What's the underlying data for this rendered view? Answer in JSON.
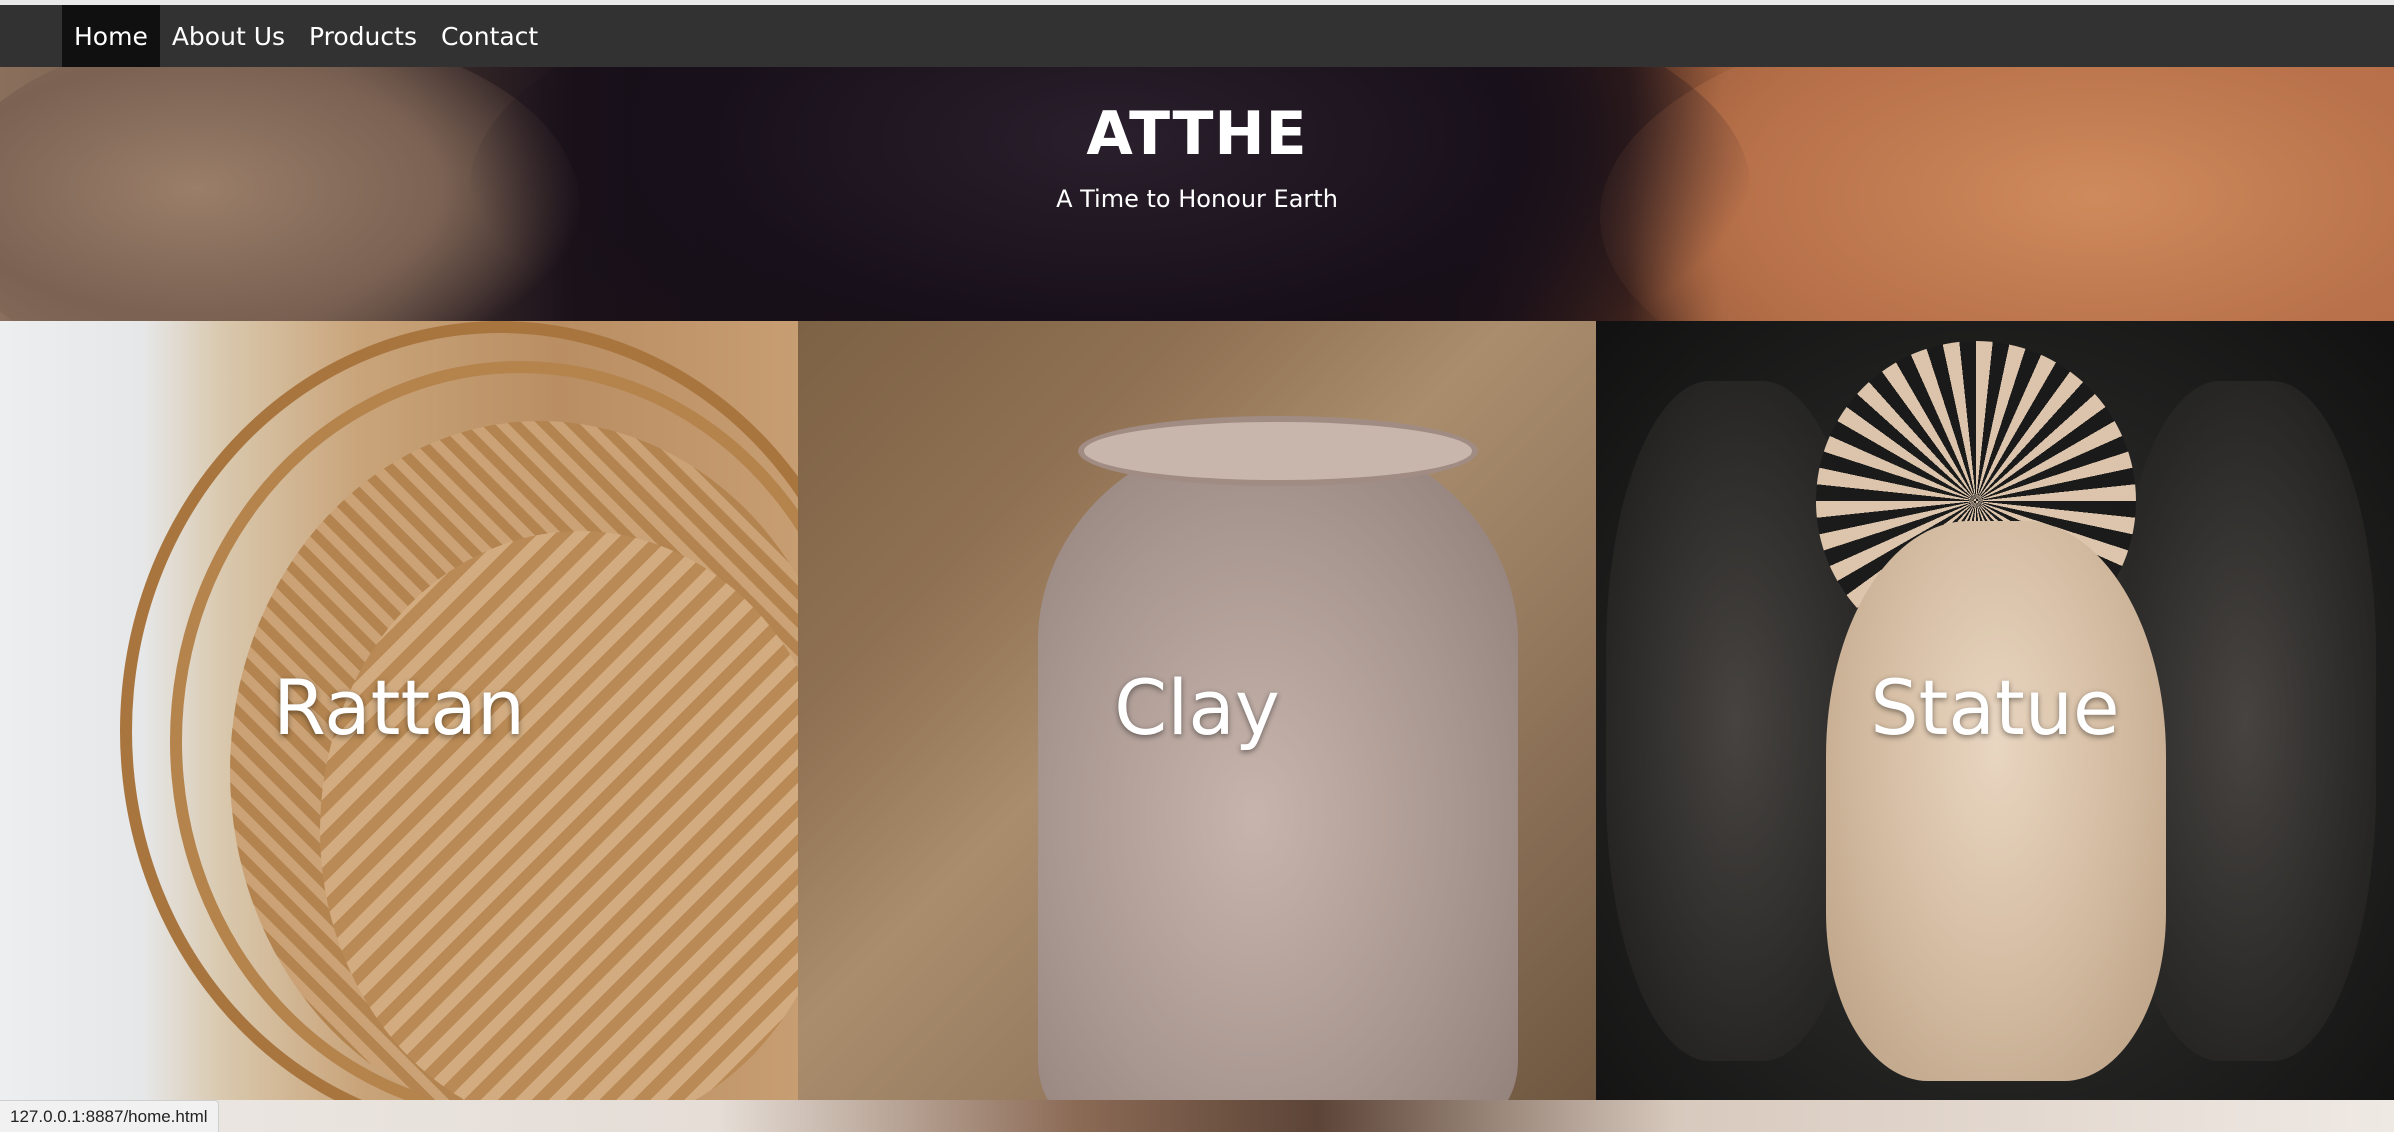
{
  "nav": {
    "items": [
      {
        "label": "Home",
        "active": true
      },
      {
        "label": "About Us",
        "active": false
      },
      {
        "label": "Products",
        "active": false
      },
      {
        "label": "Contact",
        "active": false
      }
    ]
  },
  "hero": {
    "title": "ATTHE",
    "subtitle": "A Time to Honour Earth"
  },
  "categories": [
    {
      "label": "Rattan"
    },
    {
      "label": "Clay"
    },
    {
      "label": "Statue"
    }
  ],
  "status_bar": {
    "url": "127.0.0.1:8887/home.html"
  },
  "colors": {
    "navbar_bg": "#323232",
    "nav_active_bg": "#101010",
    "text": "#ffffff"
  }
}
